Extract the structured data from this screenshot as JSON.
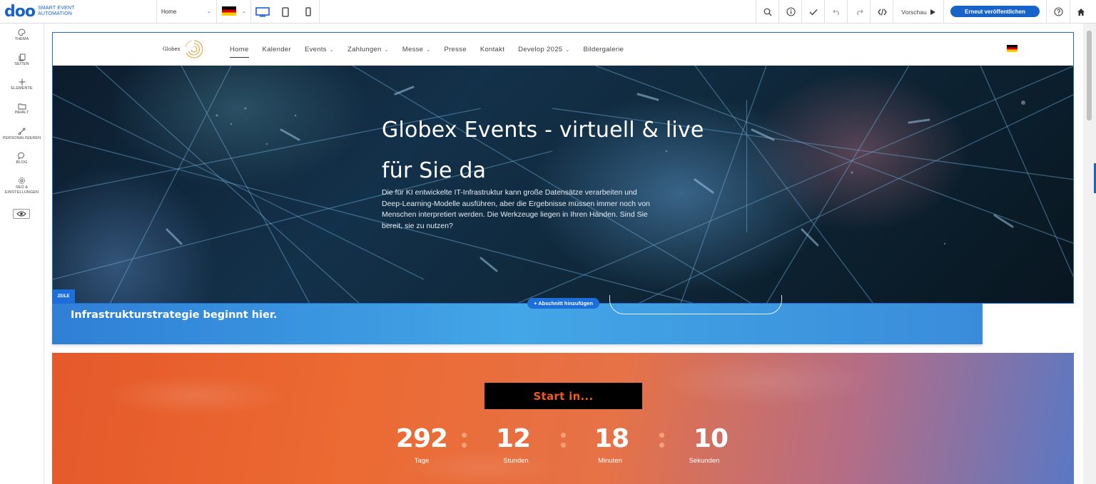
{
  "app": {
    "logo_word": "doo",
    "logo_tag_line1": "SMART EVENT",
    "logo_tag_line2": "AUTOMATION",
    "page_selector": "Home",
    "preview_label": "Vorschau",
    "publish_label": "Erneut veröffentlichen",
    "accent_color": "#1763c8"
  },
  "toolbar_icons": [
    "monitor-icon",
    "tablet-icon",
    "phone-icon",
    "search-icon",
    "info-icon",
    "check-icon",
    "undo-icon",
    "redo-icon",
    "code-icon",
    "play-icon",
    "help-icon",
    "home-icon"
  ],
  "sidebar": {
    "items": [
      {
        "label": "THEMA",
        "icon": "palette-icon"
      },
      {
        "label": "SEITEN",
        "icon": "pages-icon"
      },
      {
        "label": "ELEMENTE",
        "icon": "plus-icon"
      },
      {
        "label": "INHALT",
        "icon": "folder-icon"
      },
      {
        "label": "PERSONALISIEREN",
        "icon": "personalize-icon"
      },
      {
        "label": "BLOG",
        "icon": "chat-icon"
      },
      {
        "label": "SEO &",
        "label2": "EINSTELLUNGEN",
        "icon": "gear-icon"
      }
    ]
  },
  "site": {
    "logo_text": "Globex",
    "nav": [
      {
        "label": "Home",
        "active": true,
        "dropdown": false
      },
      {
        "label": "Kalender",
        "dropdown": false
      },
      {
        "label": "Events",
        "dropdown": true
      },
      {
        "label": "Zahlungen",
        "dropdown": true
      },
      {
        "label": "Messe",
        "dropdown": true
      },
      {
        "label": "Presse",
        "dropdown": false
      },
      {
        "label": "Kontakt",
        "dropdown": false
      },
      {
        "label": "Develop 2025",
        "dropdown": true
      },
      {
        "label": "Bildergalerie",
        "dropdown": false
      }
    ],
    "hero": {
      "title_line1": "Globex Events - virtuell & live",
      "title_line2": "für Sie da",
      "text": "Die für KI entwickelte IT-Infrastruktur kann große Datensätze verarbeiten und Deep-Learning-Modelle ausführen, aber die Ergebnisse müssen immer noch von Menschen interpretiert werden. Die Werkzeuge liegen in Ihren Händen. Sind Sie bereit, sie zu nutzen?"
    },
    "row_badge": "ZEILE",
    "add_section": "+ Abschnitt hinzufügen",
    "blue_band_text": "Infrastrukturstrategie beginnt hier.",
    "countdown": {
      "heading": "Start in...",
      "units": [
        {
          "value": "292",
          "label": "Tage"
        },
        {
          "value": "12",
          "label": "Stunden"
        },
        {
          "value": "18",
          "label": "Minuten"
        },
        {
          "value": "10",
          "label": "Sekunden"
        }
      ]
    }
  }
}
